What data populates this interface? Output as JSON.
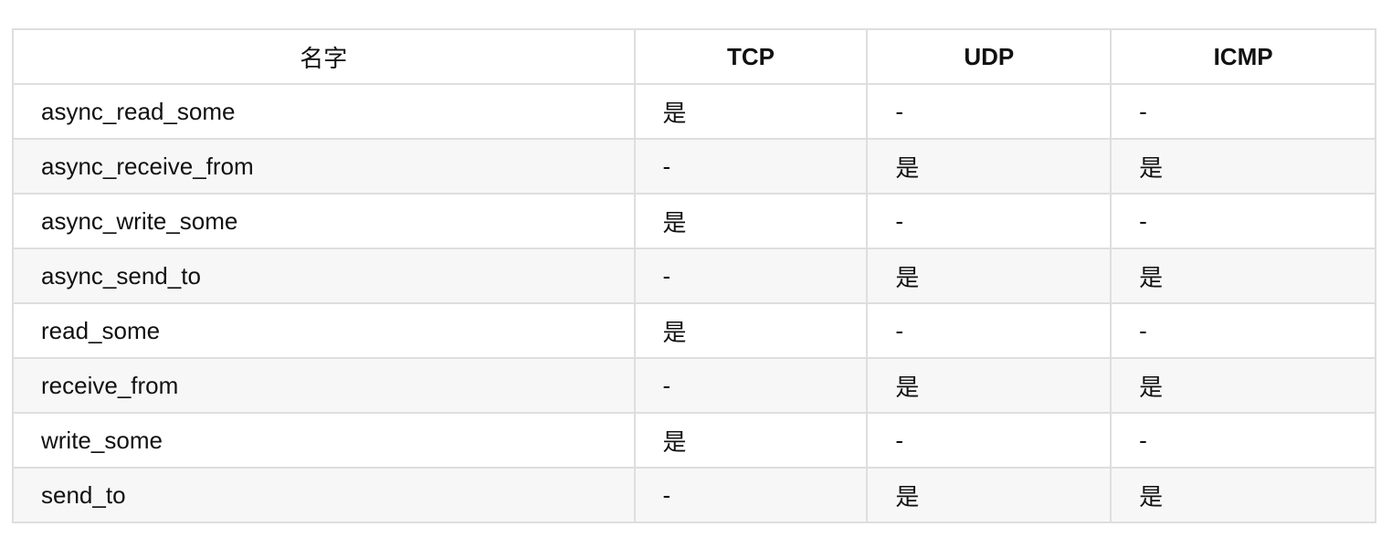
{
  "headers": [
    "名字",
    "TCP",
    "UDP",
    "ICMP"
  ],
  "rows": [
    [
      "async_read_some",
      "是",
      "-",
      "-"
    ],
    [
      "async_receive_from",
      "-",
      "是",
      "是"
    ],
    [
      "async_write_some",
      "是",
      "-",
      "-"
    ],
    [
      "async_send_to",
      "-",
      "是",
      "是"
    ],
    [
      "read_some",
      "是",
      "-",
      "-"
    ],
    [
      "receive_from",
      "-",
      "是",
      "是"
    ],
    [
      "write_some",
      "是",
      "-",
      "-"
    ],
    [
      "send_to",
      "-",
      "是",
      "是"
    ]
  ]
}
